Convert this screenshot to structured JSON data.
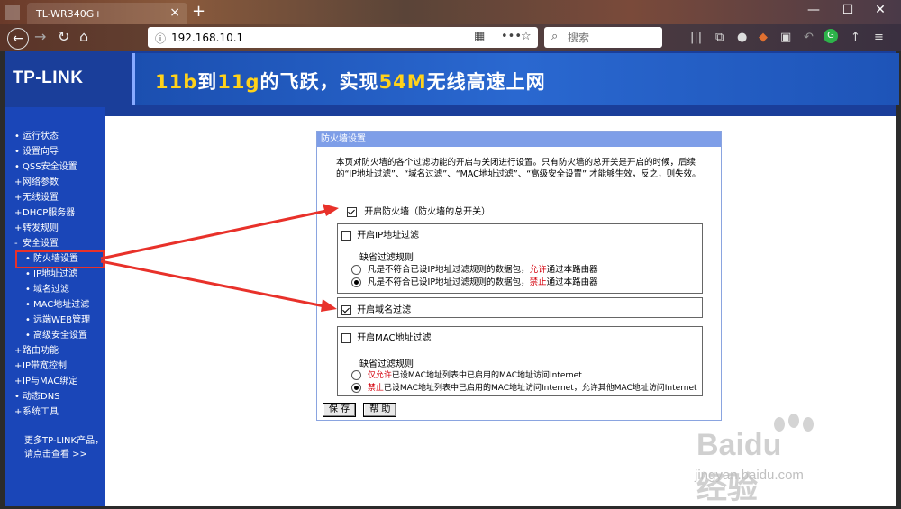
{
  "browser": {
    "tab_title": "TL-WR340G+",
    "tab_close": "×",
    "new_tab": "+",
    "url": "192.168.10.1",
    "search_placeholder": "搜索",
    "window_controls": {
      "minimize": "—",
      "maximize": "☐",
      "close": "✕"
    }
  },
  "router": {
    "logo": "TP-LINK",
    "slogan": {
      "p1": "11b",
      "p2": "到",
      "p3": "11g",
      "p4": "的飞跃，实现",
      "p5": "54M",
      "p6": "无线高速上网"
    },
    "menu": [
      {
        "label": "运行状态",
        "bullet": "•",
        "sub": false
      },
      {
        "label": "设置向导",
        "bullet": "•",
        "sub": false
      },
      {
        "label": "QSS安全设置",
        "bullet": "•",
        "sub": false
      },
      {
        "label": "网络参数",
        "bullet": "+",
        "sub": false
      },
      {
        "label": "无线设置",
        "bullet": "+",
        "sub": false
      },
      {
        "label": "DHCP服务器",
        "bullet": "+",
        "sub": false
      },
      {
        "label": "转发规则",
        "bullet": "+",
        "sub": false
      },
      {
        "label": "安全设置",
        "bullet": "-",
        "sub": false
      },
      {
        "label": "防火墙设置",
        "bullet": "•",
        "sub": true
      },
      {
        "label": "IP地址过滤",
        "bullet": "•",
        "sub": true
      },
      {
        "label": "域名过滤",
        "bullet": "•",
        "sub": true
      },
      {
        "label": "MAC地址过滤",
        "bullet": "•",
        "sub": true
      },
      {
        "label": "远端WEB管理",
        "bullet": "•",
        "sub": true
      },
      {
        "label": "高级安全设置",
        "bullet": "•",
        "sub": true
      },
      {
        "label": "路由功能",
        "bullet": "+",
        "sub": false
      },
      {
        "label": "IP带宽控制",
        "bullet": "+",
        "sub": false
      },
      {
        "label": "IP与MAC绑定",
        "bullet": "+",
        "sub": false
      },
      {
        "label": "动态DNS",
        "bullet": "•",
        "sub": false
      },
      {
        "label": "系统工具",
        "bullet": "+",
        "sub": false
      }
    ],
    "more_line1": "更多TP-LINK产品，",
    "more_line2": "请点击查看 >>"
  },
  "firewall": {
    "title": "防火墙设置",
    "description": "本页对防火墙的各个过滤功能的开启与关闭进行设置。只有防火墙的总开关是开启的时候，后续的“IP地址过滤”、“域名过滤”、“MAC地址过滤”、“高级安全设置” 才能够生效，反之，则失效。",
    "master_label": "开启防火墙（防火墙的总开关）",
    "master_checked": true,
    "ip_filter": {
      "label": "开启IP地址过滤",
      "checked": false,
      "rule_title": "缺省过滤规则",
      "opt1_pre": "凡是不符合已设IP地址过滤规则的数据包，",
      "opt1_red": "允许",
      "opt1_post": "通过本路由器",
      "opt2_pre": "凡是不符合已设IP地址过滤规则的数据包，",
      "opt2_red": "禁止",
      "opt2_post": "通过本路由器",
      "selected": 2
    },
    "domain_filter": {
      "label": "开启域名过滤",
      "checked": true
    },
    "mac_filter": {
      "label": "开启MAC地址过滤",
      "checked": false,
      "rule_title": "缺省过滤规则",
      "opt1_red": "仅允许",
      "opt1_post": "已设MAC地址列表中已启用的MAC地址访问Internet",
      "opt2_red": "禁止",
      "opt2_post": "已设MAC地址列表中已启用的MAC地址访问Internet，允许其他MAC地址访问Internet",
      "selected": 2
    },
    "save_label": "保 存",
    "help_label": "帮 助"
  },
  "watermark": {
    "brand": "Baidu经验",
    "site": "jingyan.baidu.com"
  },
  "colors": {
    "router_blue": "#1a46b8",
    "panel_header": "#7e9ee8",
    "annotation_red": "#e8312a"
  }
}
